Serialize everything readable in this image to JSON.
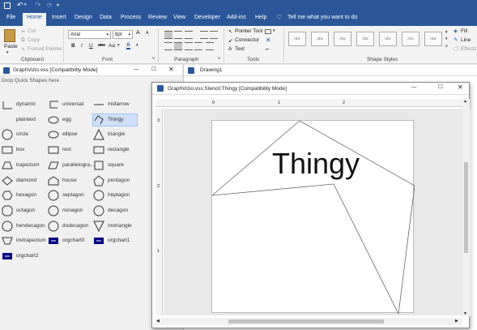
{
  "qat": {},
  "tabs": [
    "File",
    "Home",
    "Insert",
    "Design",
    "Data",
    "Process",
    "Review",
    "View",
    "Developer",
    "Add-ins",
    "Help"
  ],
  "tell_me": "Tell me what you want to do",
  "clipboard": {
    "paste": "Paste",
    "cut": "Cut",
    "copy": "Copy",
    "format_painter": "Format Painter",
    "label": "Clipboard"
  },
  "font": {
    "name": "Arial",
    "size": "8pt",
    "label": "Font",
    "grow": "A",
    "shrink": "A",
    "bold": "B",
    "italic": "I",
    "underline": "U",
    "strike": "abc",
    "case": "Aa",
    "color": "A"
  },
  "paragraph": {
    "label": "Paragraph"
  },
  "tools": {
    "pointer": "Pointer Tool",
    "connector": "Connector",
    "text": "Text",
    "label": "Tools"
  },
  "shape_styles": {
    "label": "Shape Styles",
    "thumb": "Abc"
  },
  "shape_fmt": {
    "fill": "Fill",
    "line": "Line",
    "effects": "Effects"
  },
  "left_window": {
    "title": "GraphVizio.vss  [Compatibility Mode]",
    "drop_hint": "Drop Quick Shapes here"
  },
  "drawing_window": {
    "title": "Drawing1"
  },
  "stencil_window": {
    "title": "GraphVizio.vss:Stencil:Thingy  [Compatibility Mode]"
  },
  "shapes": [
    [
      "dynamic",
      "universal",
      "midarrow"
    ],
    [
      "plaintext",
      "egg",
      "Thingy"
    ],
    [
      "circle",
      "ellipse",
      "triangle"
    ],
    [
      "box",
      "rect",
      "rectangle"
    ],
    [
      "trapezium",
      "parallelogra...",
      "square"
    ],
    [
      "diamond",
      "house",
      "pentagon"
    ],
    [
      "hexagon",
      "septagon",
      "heptagon"
    ],
    [
      "octagon",
      "nonagon",
      "decagon"
    ],
    [
      "hendecagon",
      "dodecagon",
      "invtriangle"
    ],
    [
      "invtrapezium",
      "orgchart0",
      "orgchart1"
    ],
    [
      "orgchart2"
    ]
  ],
  "ruler": {
    "top": [
      "0",
      "1",
      "2"
    ],
    "left": [
      "3",
      "2",
      "1"
    ]
  },
  "canvas_text": "Thingy",
  "colors": {
    "accent": "#2b579a",
    "selected": "#cde0f7"
  }
}
